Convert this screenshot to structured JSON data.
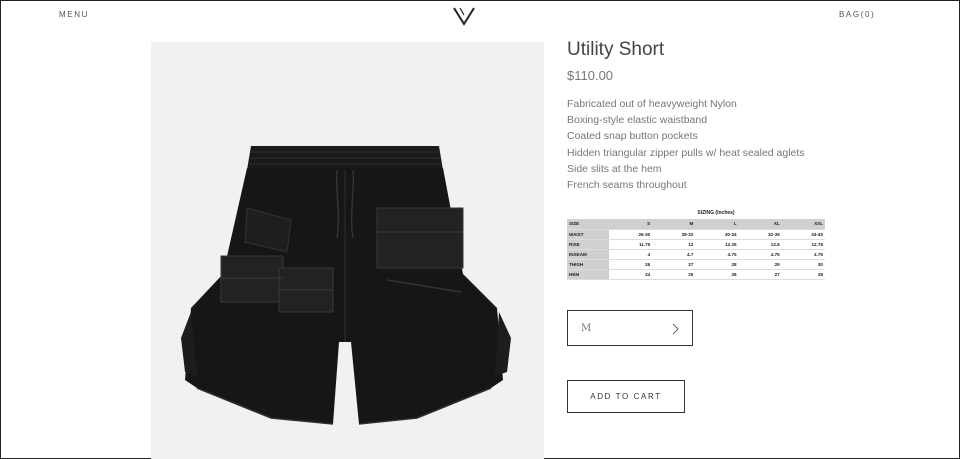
{
  "header": {
    "menu_label": "MENU",
    "bag_label": "BAG(0)",
    "logo_letter": "V"
  },
  "product": {
    "title": "Utility Short",
    "price": "$110.00",
    "image_alt": "Black nylon utility short with cargo pockets",
    "features": [
      "Fabricated out of heavyweight Nylon",
      "Boxing-style elastic waistband",
      "Coated snap button pockets",
      "Hidden triangular zipper pulls w/ heat sealed aglets",
      "Side slits at the hem",
      "French seams throughout"
    ]
  },
  "sizing": {
    "title": "SIZING (Inches)",
    "headers": [
      "SIZE",
      "S",
      "M",
      "L",
      "XL",
      "XXL"
    ],
    "rows": [
      [
        "WAIST",
        "26-30",
        "28-32",
        "30-34",
        "32-36",
        "34-40"
      ],
      [
        "RISE",
        "11.75",
        "12",
        "12.25",
        "12.5",
        "12.75"
      ],
      [
        "INSEAM",
        "4",
        "4.7",
        "4.75",
        "4.75",
        "4.75"
      ],
      [
        "THIGH",
        "26",
        "27",
        "28",
        "29",
        "30"
      ],
      [
        "HEM",
        "24",
        "25",
        "26",
        "27",
        "28"
      ]
    ]
  },
  "size_select": {
    "value": "M",
    "icon": "chevron-right-icon"
  },
  "cart": {
    "add_label": "ADD TO CART"
  }
}
